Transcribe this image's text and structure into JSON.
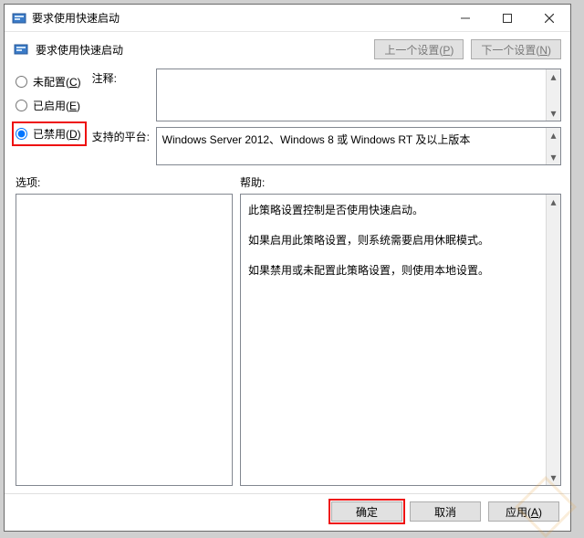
{
  "window": {
    "title": "要求使用快速启动"
  },
  "header": {
    "policy_title": "要求使用快速启动",
    "prev_button": "上一个设置(P)",
    "next_button": "下一个设置(N)"
  },
  "radios": {
    "not_configured": "未配置(C)",
    "enabled": "已启用(E)",
    "disabled": "已禁用(D)",
    "selected": "disabled"
  },
  "fields": {
    "comment_label": "注释:",
    "comment_value": "",
    "platform_label": "支持的平台:",
    "platform_value": "Windows Server 2012、Windows 8 或 Windows RT 及以上版本"
  },
  "sections": {
    "options_label": "选项:",
    "help_label": "帮助:"
  },
  "help": {
    "p1": "此策略设置控制是否使用快速启动。",
    "p2": "如果启用此策略设置，则系统需要启用休眠模式。",
    "p3": "如果禁用或未配置此策略设置，则使用本地设置。"
  },
  "buttons": {
    "ok": "确定",
    "cancel": "取消",
    "apply": "应用(A)"
  }
}
